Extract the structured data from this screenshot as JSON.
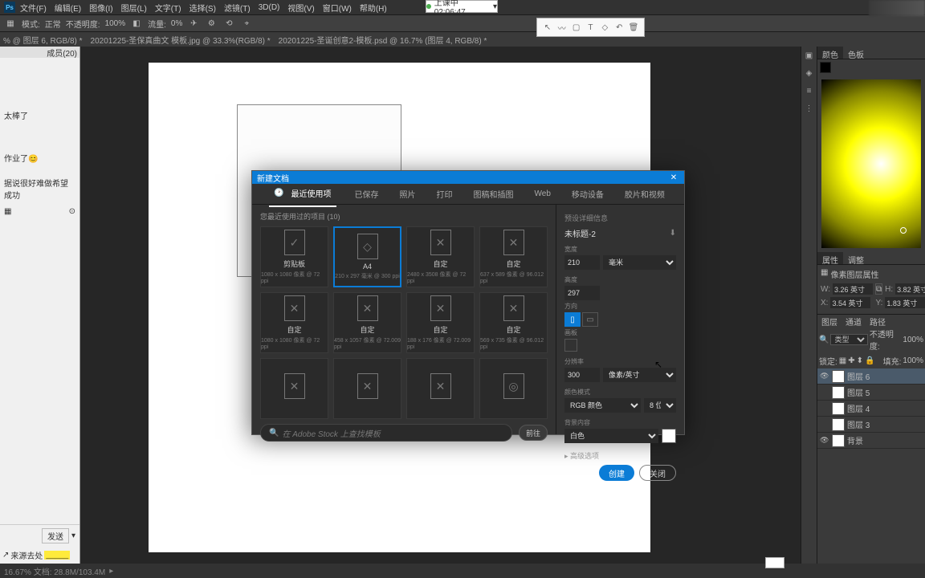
{
  "menubar": {
    "items": [
      "文件(F)",
      "编辑(E)",
      "图像(I)",
      "图层(L)",
      "文字(T)",
      "选择(S)",
      "滤镜(T)",
      "3D(D)",
      "视图(V)",
      "窗口(W)",
      "帮助(H)"
    ]
  },
  "optbar": {
    "mode": "模式:",
    "mode_val": "正常",
    "opacity_lbl": "不透明度:",
    "opacity": "100%",
    "flow_lbl": "流量:",
    "flow": "0%"
  },
  "doctabs": {
    "t1": "% @ 图层 6, RGB/8) *",
    "t2": "20201225-圣保真曲文 模板.jpg @ 33.3%(RGB/8) *",
    "t3": "20201225-圣诞创意2-模板.psd @ 16.7% (图层 4, RGB/8) *"
  },
  "float_ind": "上课中 02:06:47",
  "left_sidebar": {
    "hdr_l": "",
    "hdr_r": "成员(20)",
    "i1": "太棒了",
    "i2": "作业了😊",
    "i3": "据说很好难做希望成功",
    "btn": "发送",
    "b1": "",
    "b2": "来源去处",
    "b3": "_____"
  },
  "dialog": {
    "title": "新建文档",
    "tabs": [
      "最近使用项",
      "已保存",
      "照片",
      "打印",
      "图稿和插图",
      "Web",
      "移动设备",
      "胶片和视频"
    ],
    "recent_lbl": "您最近使用过的项目 (10)",
    "presets": [
      {
        "nm": "剪贴板",
        "sz": "1080 x 1080 像素 @ 72 ppi",
        "icon": "✓"
      },
      {
        "nm": "A4",
        "sz": "210 x 297 毫米 @ 300 ppi",
        "icon": "◇"
      },
      {
        "nm": "自定",
        "sz": "2480 x 3508 像素 @ 72 ppi",
        "icon": "✕"
      },
      {
        "nm": "自定",
        "sz": "637 x 589 像素 @ 96.012 ppi",
        "icon": "✕"
      },
      {
        "nm": "自定",
        "sz": "1080 x 1080 像素 @ 72 ppi",
        "icon": "✕"
      },
      {
        "nm": "自定",
        "sz": "458 x 1057 像素 @ 72.009 ppi",
        "icon": "✕"
      },
      {
        "nm": "自定",
        "sz": "188 x 176 像素 @ 72.009 ppi",
        "icon": "✕"
      },
      {
        "nm": "自定",
        "sz": "569 x 735 像素 @ 96.012 ppi",
        "icon": "✕"
      },
      {
        "nm": "",
        "sz": "",
        "icon": "✕"
      },
      {
        "nm": "",
        "sz": "",
        "icon": "✕"
      },
      {
        "nm": "",
        "sz": "",
        "icon": "✕"
      },
      {
        "nm": "",
        "sz": "",
        "icon": "◎"
      }
    ],
    "search_ph": "在 Adobe Stock 上查找模板",
    "go": "前往",
    "preset_detail": "预设详细信息",
    "doc_name": "未标题-2",
    "width_lbl": "宽度",
    "width": "210",
    "unit": "毫米",
    "height_lbl": "高度",
    "height": "297",
    "orient_lbl": "方向",
    "artboard_lbl": "画板",
    "res_lbl": "分辨率",
    "res": "300",
    "res_unit": "像素/英寸",
    "colormode_lbl": "颜色模式",
    "colormode": "RGB 颜色",
    "bits": "8 位",
    "bg_lbl": "背景内容",
    "bg": "白色",
    "advanced": "▸ 高级选项",
    "create": "创建",
    "close": "关闭"
  },
  "right_panels": {
    "tabs1": [
      "颜色",
      "色板"
    ],
    "tabs2": [
      "属性",
      "调整"
    ],
    "prop_title": "像素图层属性",
    "w_lbl": "W:",
    "w": "3.26 英寸",
    "h_lbl": "H:",
    "h": "3.82 英寸",
    "x_lbl": "X:",
    "x": "3.54 英寸",
    "y_lbl": "Y:",
    "y": "1.83 英寸",
    "layer_tabs": [
      "图层",
      "通道",
      "路径"
    ],
    "kind": "类型",
    "opacity_lbl": "不透明度:",
    "opacity": "100%",
    "fill_lbl": "填充:",
    "fill": "100%",
    "lock": "锁定:",
    "layers": [
      {
        "name": "图层 6",
        "vis": true,
        "sel": true
      },
      {
        "name": "图层 5",
        "vis": false,
        "sel": false
      },
      {
        "name": "图层 4",
        "vis": false,
        "sel": false
      },
      {
        "name": "图层 3",
        "vis": false,
        "sel": false
      },
      {
        "name": "背景",
        "vis": true,
        "sel": false
      }
    ]
  },
  "status": "16.67%    文档: 28.8M/103.4M"
}
